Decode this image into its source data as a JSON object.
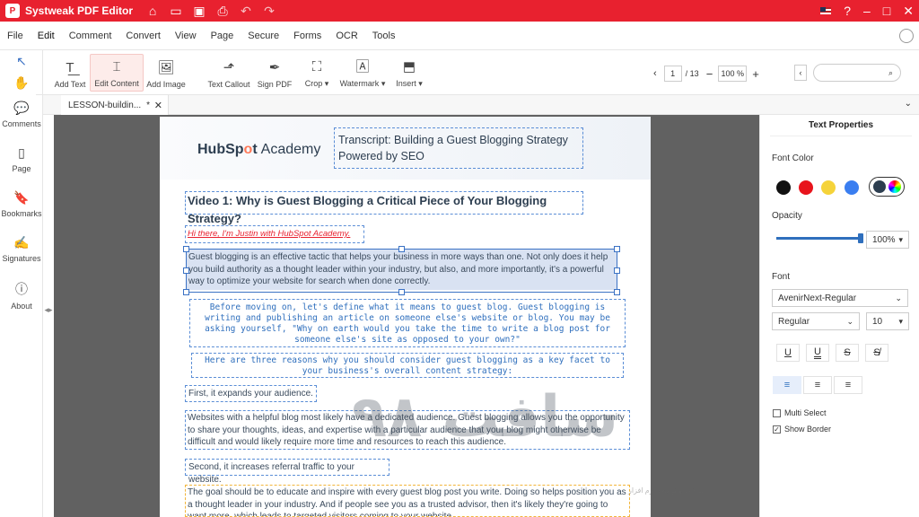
{
  "titlebar": {
    "app_title": "Systweak PDF Editor"
  },
  "menu": [
    "File",
    "Edit",
    "Comment",
    "Convert",
    "View",
    "Page",
    "Secure",
    "Forms",
    "OCR",
    "Tools"
  ],
  "tools": {
    "add_text": "Add Text",
    "edit_content": "Edit Content",
    "add_image": "Add Image",
    "text_callout": "Text Callout",
    "sign_pdf": "Sign PDF",
    "crop": "Crop",
    "watermark": "Watermark",
    "insert": "Insert"
  },
  "pager": {
    "current_page": "1",
    "total": "/ 13",
    "zoom": "100 %"
  },
  "left_rail": {
    "comments": "Comments",
    "page": "Page",
    "bookmarks": "Bookmarks",
    "signatures": "Signatures",
    "about": "About"
  },
  "tab": {
    "title": "LESSON-buildin...",
    "modified_mark": "*"
  },
  "document": {
    "logo_part1": "HubSp",
    "logo_o": "o",
    "logo_part2": "t",
    "logo_academy": "Academy",
    "transcript_title": "Transcript: Building a Guest Blogging Strategy Powered by SEO",
    "heading": "Video 1: Why is Guest Blogging a Critical Piece of Your Blogging Strategy?",
    "greeting": "Hi there, I'm Justin with HubSpot Academy.",
    "para1": "Guest blogging is an effective tactic that helps your business in more ways than one. Not only does it help you build authority as a thought leader within your industry, but also, and more importantly, it's a powerful way to optimize your website for search when done correctly.",
    "mono1": "Before moving on, let's define what it means to guest blog. Guest blogging is writing and publishing an article on someone else's website or blog. You may be asking yourself, \"Why on earth would you take the time to write a blog post for someone else's site as opposed to your own?\"",
    "mono2": "Here are three reasons why you should consider guest blogging as a key facet to your business's overall content strategy:",
    "first": "First, it expands your audience.",
    "para2": "Websites with a helpful blog most likely have a dedicated audience. Guest blogging allows you the opportunity to share your thoughts, ideas, and expertise with a particular audience that your blog might otherwise be difficult and would likely require more time and resources to reach this audience.",
    "second": "Second, it increases referral traffic to your website.",
    "para3": "The goal should be to educate and inspire with every guest blog post you write. Doing so helps position you as a thought leader in your industry. And if people see you as a trusted advisor, then it's likely they're going to want more, which leads to targeted visitors coming to your website."
  },
  "panel": {
    "title": "Text Properties",
    "font_color_label": "Font Color",
    "colors": [
      "#111111",
      "#e8141c",
      "#f5d33a",
      "#3a7ef0",
      "#2d3e50"
    ],
    "opacity_label": "Opacity",
    "opacity_value": "100%",
    "opacity_level": 1.0,
    "font_label": "Font",
    "font_family": "AvenirNext-Regular",
    "font_style": "Regular",
    "font_size": "10",
    "multi_select": "Multi Select",
    "show_border": "Show Border"
  },
  "watermark": {
    "text": "سافت ۹۸",
    "subtext": "ساخت و توسعه نرم افزار"
  }
}
